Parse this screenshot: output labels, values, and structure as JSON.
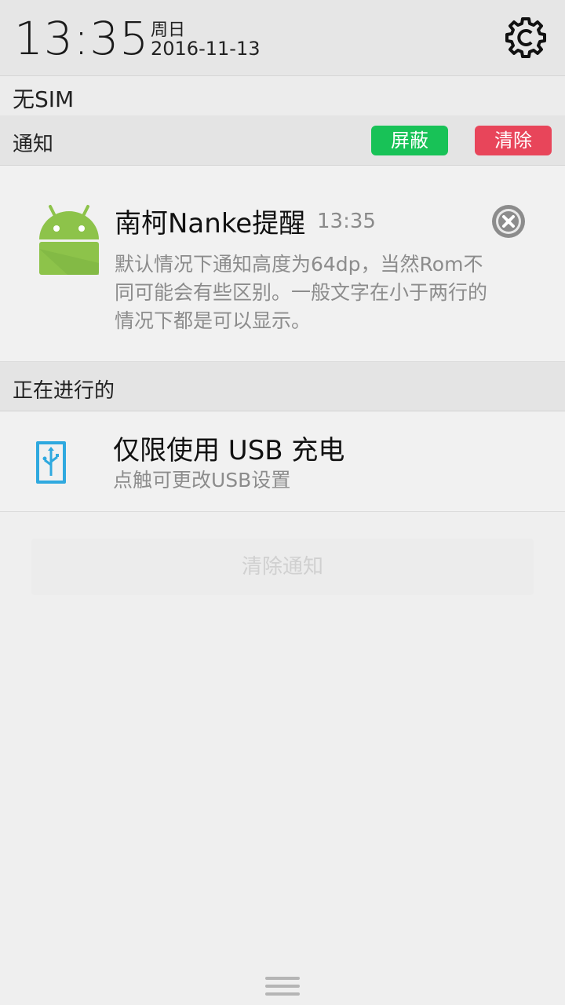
{
  "header": {
    "time": "13:35",
    "day": "周日",
    "date": "2016-11-13"
  },
  "sim": {
    "status": "无SIM"
  },
  "notifications": {
    "header": "通知",
    "block_label": "屏蔽",
    "clear_label": "清除",
    "items": [
      {
        "title": "南柯Nanke提醒",
        "time": "13:35",
        "body": "默认情况下通知高度为64dp，当然Rom不同可能会有些区别。一般文字在小于两行的情况下都是可以显示。",
        "icon": "android-icon"
      }
    ]
  },
  "ongoing": {
    "header": "正在进行的",
    "items": [
      {
        "title": "仅限使用 USB 充电",
        "subtitle": "点触可更改USB设置",
        "icon": "usb-icon"
      }
    ]
  },
  "clear_all_label": "清除通知",
  "colors": {
    "block_button": "#18c257",
    "clear_button": "#e8455a",
    "android_green": "#8dc34a",
    "usb_blue": "#2fa9df"
  }
}
